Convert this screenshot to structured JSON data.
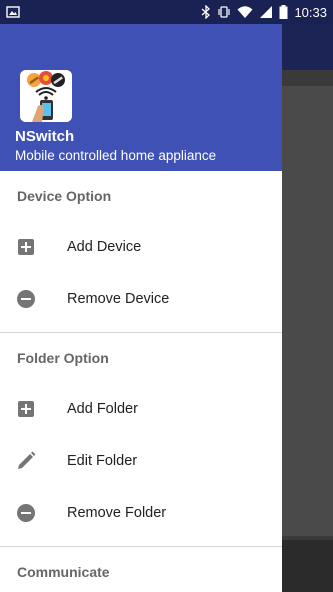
{
  "status_bar": {
    "time": "10:33"
  },
  "drawer": {
    "app_name": "NSwitch",
    "app_subtitle": "Mobile controlled home appliance",
    "sections": [
      {
        "title": "Device Option",
        "items": [
          {
            "label": "Add Device",
            "icon": "add-box-icon"
          },
          {
            "label": "Remove Device",
            "icon": "remove-circle-icon"
          }
        ]
      },
      {
        "title": "Folder Option",
        "items": [
          {
            "label": "Add Folder",
            "icon": "add-box-icon"
          },
          {
            "label": "Edit Folder",
            "icon": "pencil-icon"
          },
          {
            "label": "Remove Folder",
            "icon": "remove-circle-icon"
          }
        ]
      },
      {
        "title": "Communicate",
        "items": []
      }
    ]
  },
  "colors": {
    "header": "#3f51b5",
    "status_bar": "#1a2254",
    "icon_gray": "#757575"
  }
}
